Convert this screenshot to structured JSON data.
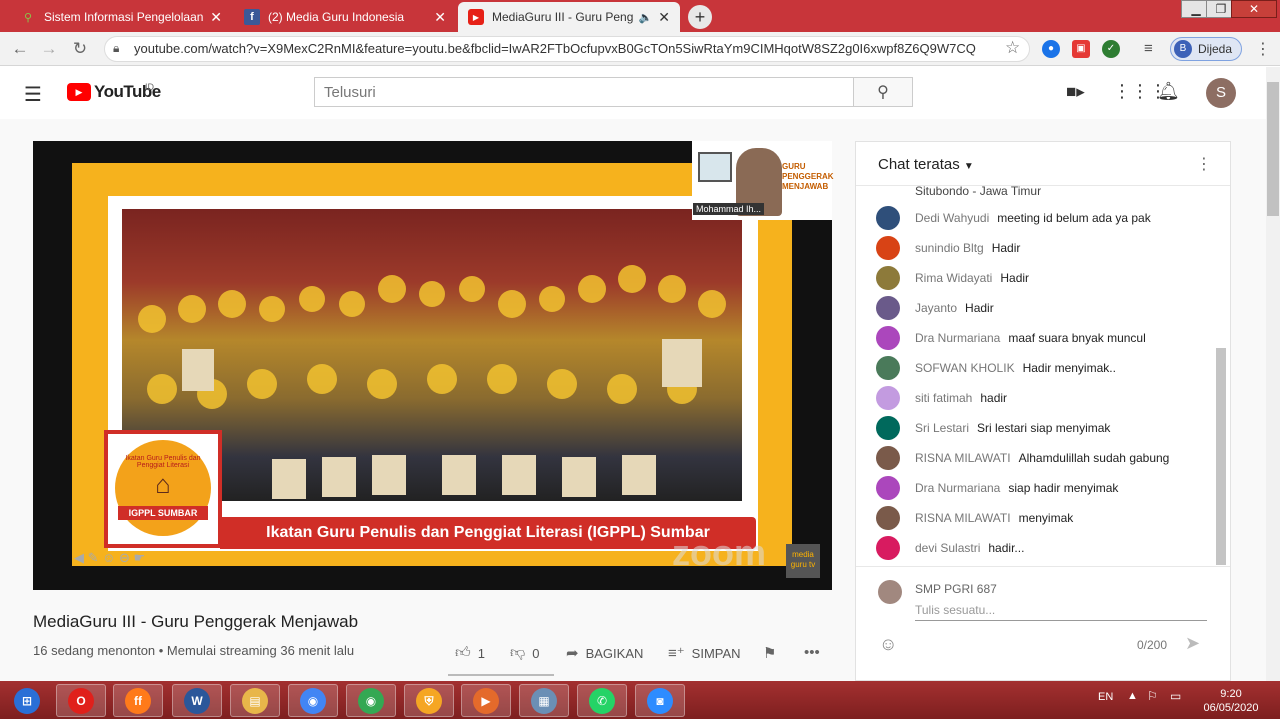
{
  "tabs": [
    {
      "title": "Sistem Informasi Pengelolaan Ke",
      "icon": "siplah-icon",
      "active": false
    },
    {
      "title": "(2) Media Guru Indonesia",
      "icon": "facebook-icon",
      "active": false
    },
    {
      "title": "MediaGuru III - Guru Pengge",
      "icon": "youtube-icon",
      "active": true
    }
  ],
  "window": {
    "minimize": "▁",
    "maximize": "❐",
    "close": "✕"
  },
  "address": {
    "url": "youtube.com/watch?v=X9MexC2RnMI&feature=youtu.be&fbclid=IwAR2FTbOcfupvxB0GcTOn5SiwRtaYm9CIMHqotW8SZ2g0I6xwpf8Z6Q9W7CQ"
  },
  "profile": {
    "initial": "B",
    "name": "Dijeda"
  },
  "youtube": {
    "logo_text": "YouTube",
    "region": "ID",
    "search_placeholder": "Telusuri",
    "avatar_initial": "S"
  },
  "video": {
    "title": "MediaGuru III - Guru Penggerak Menjawab",
    "meta": "16 sedang menonton • Memulai streaming 36 menit lalu",
    "likes": "1",
    "dislikes": "0",
    "share_label": "BAGIKAN",
    "save_label": "SIMPAN",
    "banner_caption": "Ikatan Guru Penulis dan Penggiat Literasi (IGPPL) Sumbar",
    "logo_top": "Ikatan Guru Penulis dan Penggiat Literasi",
    "logo_name": "IGPPL SUMBAR",
    "pip_name": "Mohammad Ih...",
    "pip_title": "GURU PENGGERAK MENJAWAB",
    "zoom_mark": "zoom",
    "brand_mark": "media guru tv"
  },
  "chat": {
    "title": "Chat teratas",
    "previous_line": "Situbondo - Jawa Timur",
    "messages": [
      {
        "author": "Dedi Wahyudi",
        "text": "meeting id belum ada ya pak",
        "color": "#2f4f7a"
      },
      {
        "author": "sunindio Bltg",
        "text": "Hadir",
        "color": "#d84315"
      },
      {
        "author": "Rima Widayati",
        "text": "Hadir",
        "color": "#8d7a3a"
      },
      {
        "author": "Jayanto",
        "text": "Hadir",
        "color": "#6a5a8a"
      },
      {
        "author": "Dra Nurmariana",
        "text": "maaf suara bnyak muncul",
        "color": "#ab47bc"
      },
      {
        "author": "SOFWAN KHOLIK",
        "text": "Hadir menyimak..",
        "color": "#4a7a5a"
      },
      {
        "author": "siti fatimah",
        "text": "hadir",
        "color": "#c39be0"
      },
      {
        "author": "Sri Lestari",
        "text": "Sri lestari siap menyimak",
        "color": "#00695c"
      },
      {
        "author": "RISNA MILAWATI",
        "text": "Alhamdulillah sudah gabung",
        "color": "#7a5a4a"
      },
      {
        "author": "Dra Nurmariana",
        "text": "siap hadir menyimak",
        "color": "#ab47bc"
      },
      {
        "author": "RISNA MILAWATI",
        "text": "menyimak",
        "color": "#7a5a4a"
      },
      {
        "author": "devi Sulastri",
        "text": "hadir...",
        "color": "#d81b60"
      }
    ],
    "me": "SMP PGRI 687",
    "input_placeholder": "Tulis sesuatu...",
    "counter": "0/200"
  },
  "taskbar": {
    "apps": [
      {
        "name": "start-button",
        "label": "⊞",
        "color": "#2a6fd6"
      },
      {
        "name": "opera",
        "label": "O",
        "color": "#e0201b"
      },
      {
        "name": "firefox",
        "label": "ff",
        "color": "#ff7a1a"
      },
      {
        "name": "word",
        "label": "W",
        "color": "#2b579a"
      },
      {
        "name": "explorer",
        "label": "▤",
        "color": "#e8b64a"
      },
      {
        "name": "chrome",
        "label": "◉",
        "color": "#4285f4"
      },
      {
        "name": "chrome-profile",
        "label": "◉",
        "color": "#34a853"
      },
      {
        "name": "vpn",
        "label": "⛨",
        "color": "#f5a623"
      },
      {
        "name": "media",
        "label": "▶",
        "color": "#e46a2b"
      },
      {
        "name": "network",
        "label": "▦",
        "color": "#6b8fb5"
      },
      {
        "name": "whatsapp",
        "label": "✆",
        "color": "#25d366"
      },
      {
        "name": "zoom",
        "label": "◙",
        "color": "#2d8cff"
      }
    ],
    "lang": "EN",
    "time": "9:20",
    "date": "06/05/2020"
  }
}
